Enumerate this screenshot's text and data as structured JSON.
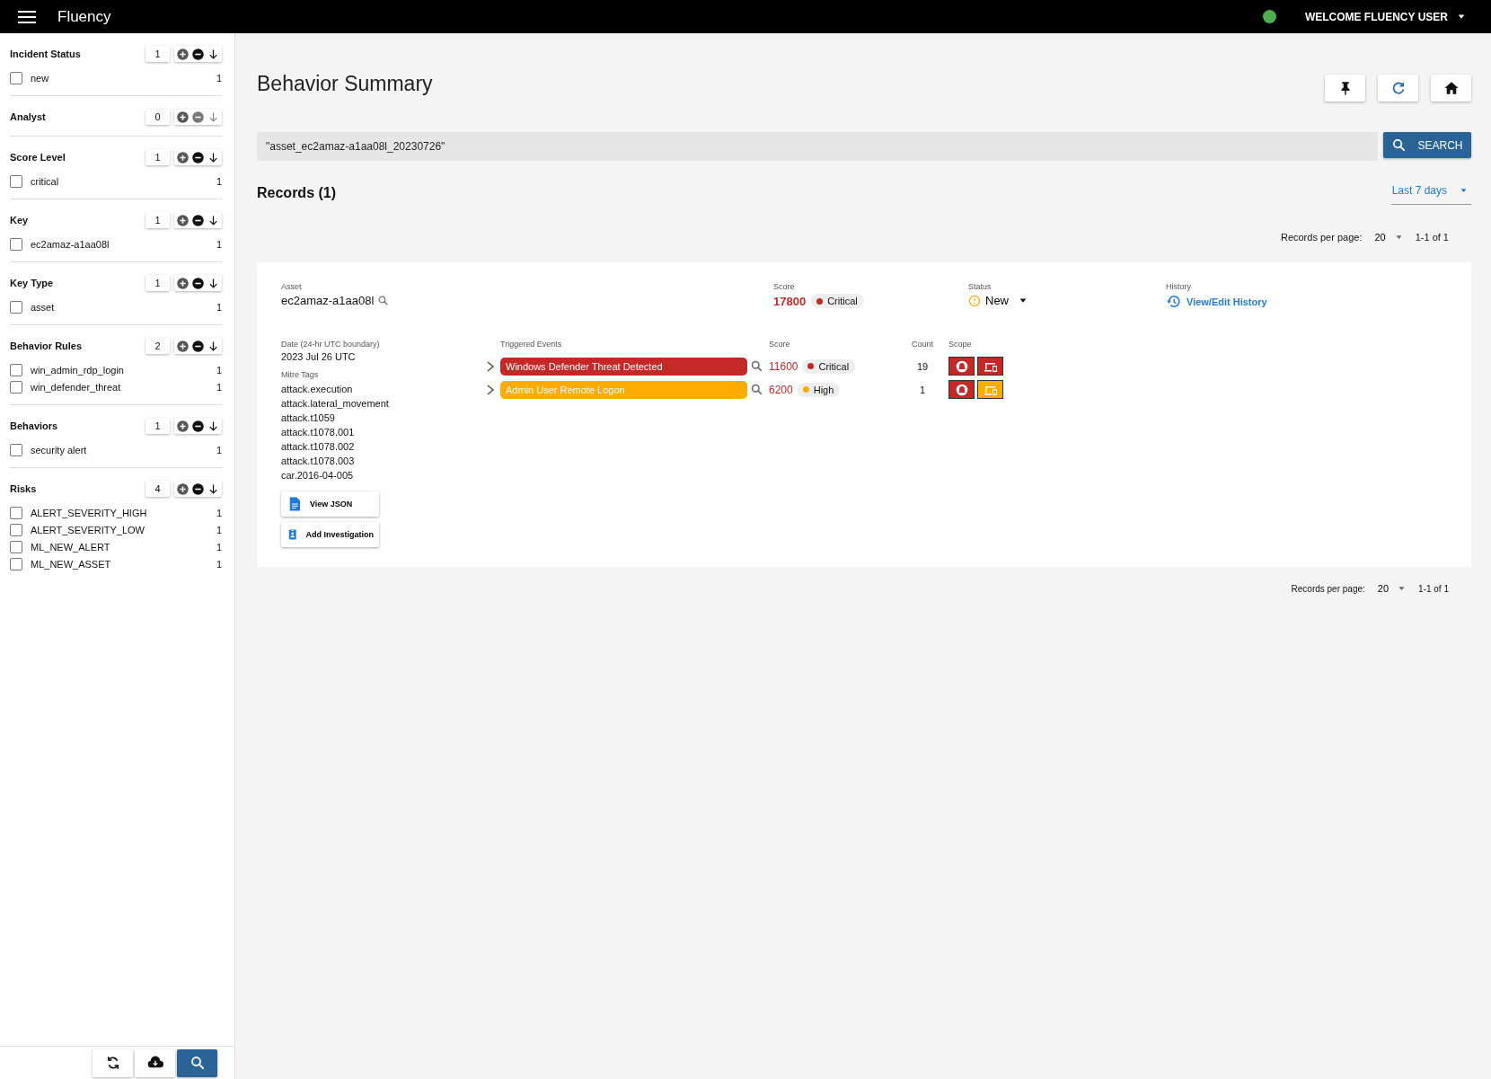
{
  "app_bar": {
    "title": "Fluency",
    "user": "WELCOME FLUENCY USER",
    "online": true
  },
  "filters": [
    {
      "title": "Incident Status",
      "count": "1",
      "actions_disabled": false,
      "items": [
        {
          "label": "new",
          "count": "1",
          "checked": false
        }
      ]
    },
    {
      "title": "Analyst",
      "count": "0",
      "actions_disabled": true
    },
    {
      "title": "Score Level",
      "count": "1",
      "actions_disabled": false,
      "items": [
        {
          "label": "critical",
          "count": "1",
          "checked": false
        }
      ]
    },
    {
      "title": "Key",
      "count": "1",
      "actions_disabled": false,
      "items": [
        {
          "label": "ec2amaz-a1aa08l",
          "count": "1",
          "checked": false
        }
      ]
    },
    {
      "title": "Key Type",
      "count": "1",
      "actions_disabled": false,
      "items": [
        {
          "label": "asset",
          "count": "1",
          "checked": false
        }
      ]
    },
    {
      "title": "Behavior Rules",
      "count": "2",
      "actions_disabled": false,
      "items": [
        {
          "label": "win_admin_rdp_login",
          "count": "1",
          "checked": false
        },
        {
          "label": "win_defender_threat",
          "count": "1",
          "checked": false
        }
      ]
    },
    {
      "title": "Behaviors",
      "count": "1",
      "actions_disabled": false,
      "items": [
        {
          "label": "security alert",
          "count": "1",
          "checked": false
        }
      ]
    },
    {
      "title": "Risks",
      "count": "4",
      "actions_disabled": false,
      "items": [
        {
          "label": "ALERT_SEVERITY_HIGH",
          "count": "1",
          "checked": false
        },
        {
          "label": "ALERT_SEVERITY_LOW",
          "count": "1",
          "checked": false
        },
        {
          "label": "ML_NEW_ALERT",
          "count": "1",
          "checked": false
        },
        {
          "label": "ML_NEW_ASSET",
          "count": "1",
          "checked": false
        }
      ]
    }
  ],
  "page_title": "Behavior Summary",
  "search": {
    "value": "\"asset_ec2amaz-a1aa08l_20230726\"",
    "button": "SEARCH"
  },
  "records_heading": "Records (1)",
  "time_range": "Last 7 days",
  "pagination_top": {
    "label": "Records per page:",
    "per_page": "20",
    "range": "1-1 of 1"
  },
  "record": {
    "asset_label": "Asset",
    "asset": "ec2amaz-a1aa08l",
    "score_label": "Score",
    "score": "17800",
    "severity": {
      "label": "Critical",
      "color": "#c62828"
    },
    "status_label": "Status",
    "status": "New",
    "history_label": "History",
    "history_link": "View/Edit History",
    "date_label": "Date (24-hr UTC boundary)",
    "date": "2023 Jul 26 UTC",
    "mitre_label": "Mitre Tags",
    "mitre_tags": [
      "attack.execution",
      "attack.lateral_movement",
      "attack.t1059",
      "attack.t1078.001",
      "attack.t1078.002",
      "attack.t1078.003",
      "car.2016-04-005"
    ],
    "buttons": [
      {
        "kind": "json",
        "label": "View JSON"
      },
      {
        "kind": "investigation",
        "label": "Add Investigation"
      }
    ],
    "events_columns": [
      "Triggered Events",
      "Score",
      "Count",
      "Scope"
    ],
    "events": [
      {
        "name": "Windows Defender Threat Detected",
        "color": "#c62828",
        "score": "11600",
        "severity": {
          "label": "Critical",
          "color": "#c62828"
        },
        "count": "19",
        "scope": [
          {
            "kind": "alert",
            "color": "#c62828"
          },
          {
            "kind": "device",
            "color": "#c62828"
          }
        ]
      },
      {
        "name": "Admin User Remote Logon",
        "color": "#ffab00",
        "score": "6200",
        "severity": {
          "label": "High",
          "color": "#ffab00"
        },
        "count": "1",
        "scope": [
          {
            "kind": "alert",
            "color": "#c62828"
          },
          {
            "kind": "device",
            "color": "#ffab00"
          }
        ]
      }
    ]
  },
  "pagination_bottom": {
    "label": "Records per page:",
    "per_page": "20",
    "range": "1-1 of 1"
  },
  "footer_buttons": [
    {
      "kind": "sync",
      "selected": false
    },
    {
      "kind": "download",
      "selected": false
    },
    {
      "kind": "search",
      "selected": true
    }
  ]
}
